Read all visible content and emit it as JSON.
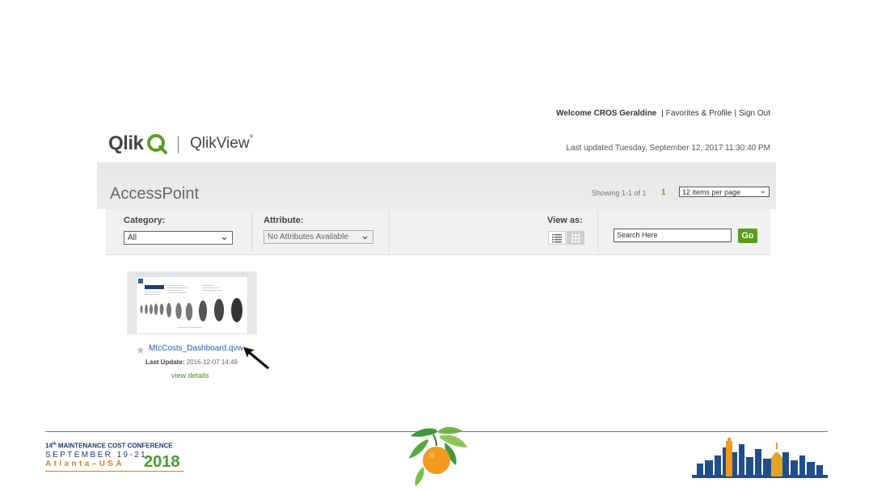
{
  "header": {
    "welcome_prefix": "Welcome",
    "user_name": "CROS Geraldine",
    "separator": "|",
    "favorites_label": "Favorites & Profile",
    "signout_label": "Sign Out",
    "last_updated": "Last updated Tuesday, September 12, 2017 11:30:40 PM"
  },
  "logo": {
    "brand": "Qlik",
    "product": "QlikView",
    "trademark": "®",
    "brand_color": "#5a9e1e"
  },
  "accesspoint": {
    "title": "AccessPoint",
    "showing": "Showing 1-1 of 1",
    "current_page": "1",
    "items_per_page": "12 items per page"
  },
  "filters": {
    "category_label": "Category:",
    "category_value": "All",
    "attribute_label": "Attribute:",
    "attribute_value": "No Attributes Available",
    "view_as_label": "View as:",
    "search_placeholder": "Search Here",
    "go_label": "Go"
  },
  "documents": [
    {
      "name": "MtcCosts_Dashboard.qvw",
      "last_update_label": "Last Update:",
      "last_update_value": "2016-12-07 14:49",
      "details_label": "view details"
    }
  ],
  "footer": {
    "conf_line1_num": "14",
    "conf_line1_sup": "th",
    "conf_line1_text": " MAINTENANCE COST CONFERENCE",
    "conf_line2": "SEPTEMBER 19-21",
    "conf_line3": "Atlanta–USA",
    "conf_year": "2018",
    "colors": {
      "navy": "#1f3b6e",
      "orange": "#e07a1a",
      "green": "#4a9d2a"
    }
  }
}
